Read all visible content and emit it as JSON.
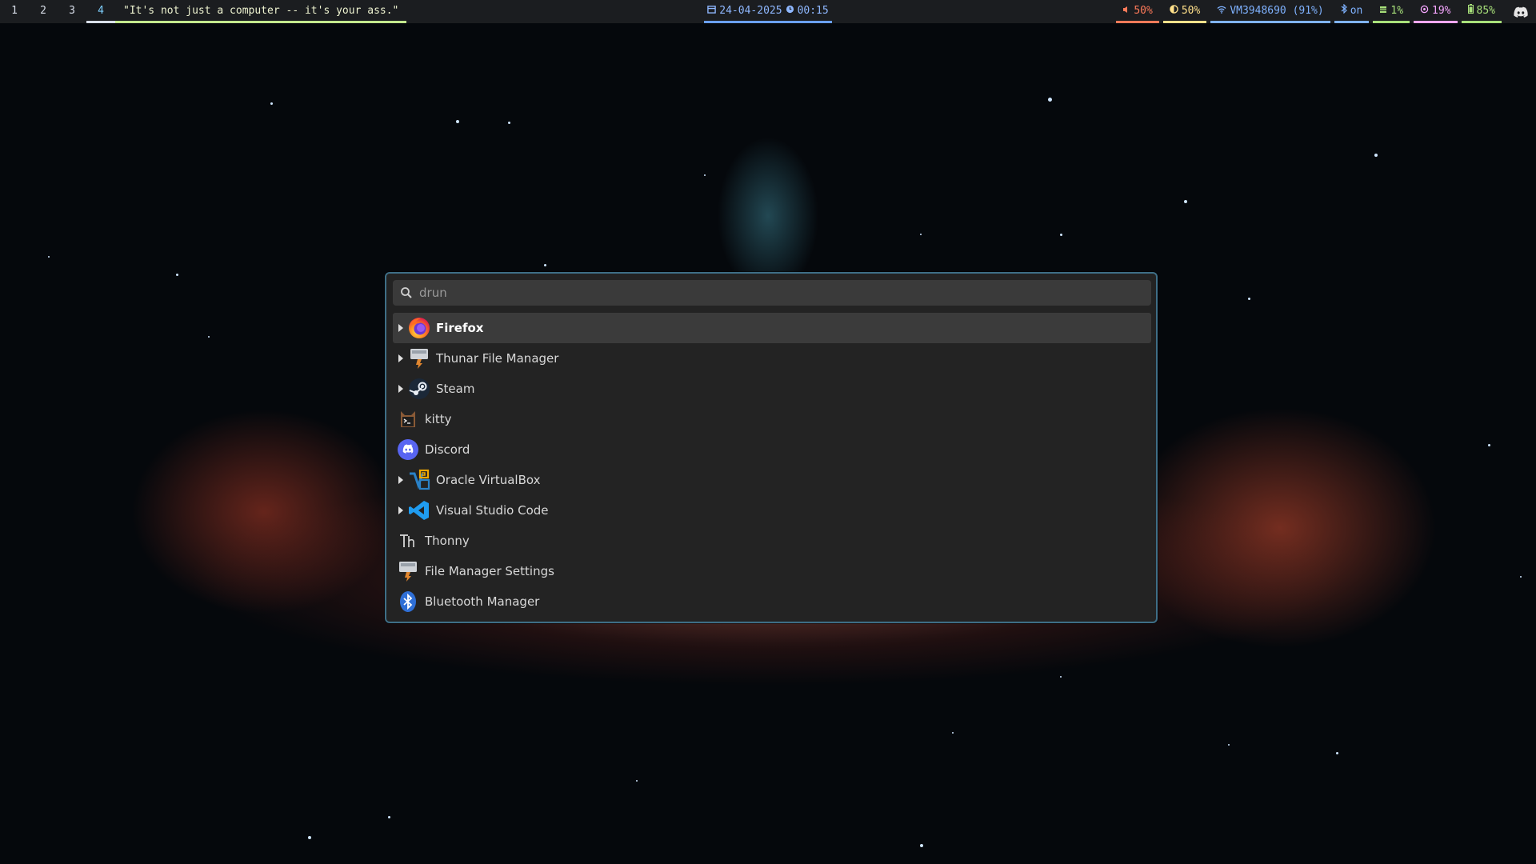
{
  "topbar": {
    "workspaces": [
      {
        "label": "1",
        "active": false
      },
      {
        "label": "2",
        "active": false
      },
      {
        "label": "3",
        "active": false
      },
      {
        "label": "4",
        "active": true
      }
    ],
    "window_title": "\"It's not just a computer -- it's your ass.\"",
    "date": "24-04-2025",
    "time": "00:15",
    "modules": {
      "volume": {
        "icon": "speaker-icon",
        "value": "50%",
        "color": "#ff7a59"
      },
      "brightness": {
        "icon": "brightness-icon",
        "value": "50%",
        "color": "#ffe08a"
      },
      "network": {
        "icon": "wifi-icon",
        "value": "VM3948690 (91%)",
        "color": "#7fb2ff"
      },
      "bluetooth": {
        "icon": "bluetooth-icon",
        "value": "on",
        "color": "#7fb2ff"
      },
      "memory": {
        "icon": "memory-icon",
        "value": "1%",
        "color": "#a8e07a"
      },
      "cpu": {
        "icon": "cpu-icon",
        "value": "19%",
        "color": "#f6a6ff"
      },
      "battery": {
        "icon": "battery-icon",
        "value": "85%",
        "color": "#a8e07a"
      }
    },
    "tray": {
      "icon": "discord-tray-icon"
    }
  },
  "launcher": {
    "search": {
      "placeholder": "drun",
      "value": ""
    },
    "items": [
      {
        "label": "Firefox",
        "icon": "firefox-icon",
        "expandable": true,
        "selected": true
      },
      {
        "label": "Thunar File Manager",
        "icon": "thunar-icon",
        "expandable": true,
        "selected": false
      },
      {
        "label": "Steam",
        "icon": "steam-icon",
        "expandable": true,
        "selected": false
      },
      {
        "label": "kitty",
        "icon": "kitty-icon",
        "expandable": false,
        "selected": false
      },
      {
        "label": "Discord",
        "icon": "discord-icon",
        "expandable": false,
        "selected": false
      },
      {
        "label": "Oracle VirtualBox",
        "icon": "virtualbox-icon",
        "expandable": true,
        "selected": false
      },
      {
        "label": "Visual Studio Code",
        "icon": "vscode-icon",
        "expandable": true,
        "selected": false
      },
      {
        "label": "Thonny",
        "icon": "thonny-icon",
        "expandable": false,
        "selected": false
      },
      {
        "label": "File Manager Settings",
        "icon": "file-manager-settings-icon",
        "expandable": false,
        "selected": false
      },
      {
        "label": "Bluetooth Manager",
        "icon": "bluetooth-manager-icon",
        "expandable": false,
        "selected": false
      }
    ]
  }
}
